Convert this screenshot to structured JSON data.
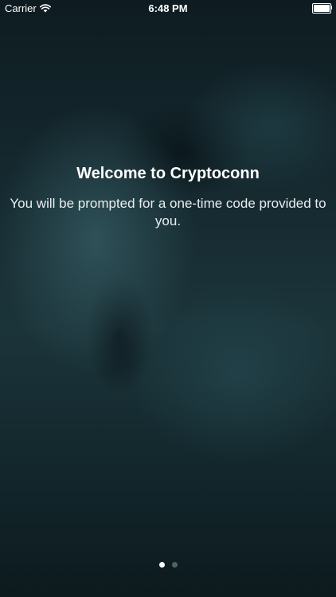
{
  "status_bar": {
    "carrier": "Carrier",
    "time": "6:48 PM",
    "battery_level": 1.0
  },
  "welcome": {
    "title": "Welcome to Cryptoconn",
    "body": "You will be prompted for a one-time code provided to you."
  },
  "pager": {
    "page_count": 2,
    "current_page": 1
  },
  "colors": {
    "text": "#ffffff",
    "background": "#15292f"
  }
}
